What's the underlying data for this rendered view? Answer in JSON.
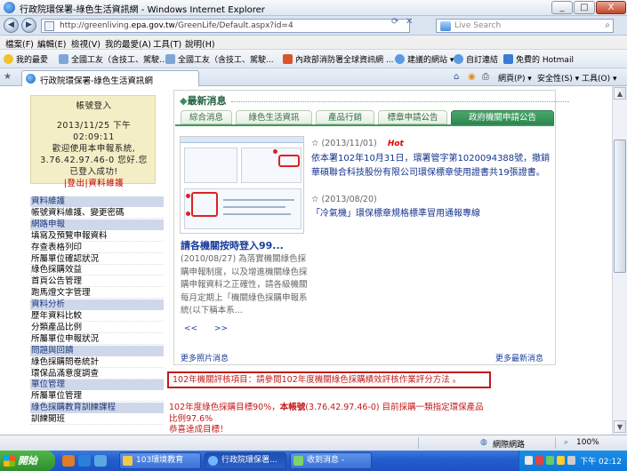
{
  "window": {
    "title": "行政院環保署-綠色生活資訊網 - Windows Internet Explorer",
    "min": "_",
    "max": "□",
    "close": "X"
  },
  "address": {
    "url_prefix": "http://greenliving.",
    "url_domain": "epa.gov.tw",
    "url_rest": "/GreenLife/Default.aspx?id=4",
    "search_placeholder": "Live Search"
  },
  "menu": [
    "檔案(F)",
    "編輯(E)",
    "檢視(V)",
    "我的最愛(A)",
    "工具(T)",
    "說明(H)"
  ],
  "favorites": {
    "label": "我的最愛",
    "items": [
      "全國工友（含技工、駕駛...",
      "全國工友（含技工、駕駛...",
      "內政部消防署全球資訊網 ...",
      "建議的網站 ▾",
      "自訂連結",
      "免費的 Hotmail"
    ]
  },
  "tab": {
    "label": "行政院環保署-綠色生活資訊網",
    "tools": [
      "網頁(P) ▾",
      "安全性(S) ▾",
      "工具(O) ▾"
    ]
  },
  "login": {
    "title": "帳號登入",
    "date": "2013/11/25 下午",
    "time": "02:09:11",
    "welcome": "歡迎使用本申報系統,",
    "ip_line": "3.76.42.97.46-0 您好.您",
    "status": "已登入成功!",
    "logout": "|登出",
    "maintain": "|資料維護"
  },
  "sidenav": [
    {
      "type": "hdr",
      "label": "資料維護"
    },
    {
      "type": "it",
      "label": "帳號資料維護、變更密碼"
    },
    {
      "type": "hdr",
      "label": "網路申報"
    },
    {
      "type": "it",
      "label": "填寫及預覽申報資料"
    },
    {
      "type": "it",
      "label": "存查表格列印"
    },
    {
      "type": "it",
      "label": "所屬單位確認狀況"
    },
    {
      "type": "it",
      "label": "綠色採購效益"
    },
    {
      "type": "it",
      "label": "首頁公告管理"
    },
    {
      "type": "it",
      "label": "跑馬燈文字管理"
    },
    {
      "type": "hdr",
      "label": "資料分析"
    },
    {
      "type": "it",
      "label": "歷年資料比較"
    },
    {
      "type": "it",
      "label": "分類產品比例"
    },
    {
      "type": "it",
      "label": "所屬單位申報狀況"
    },
    {
      "type": "hdr",
      "label": "問題與回饋"
    },
    {
      "type": "it",
      "label": "綠色採購問卷統計"
    },
    {
      "type": "it",
      "label": "環保品滿意度調查"
    },
    {
      "type": "hdr",
      "label": "單位管理"
    },
    {
      "type": "it",
      "label": "所屬單位管理"
    },
    {
      "type": "hdr",
      "label": "綠色採購教育訓練課程"
    },
    {
      "type": "it",
      "label": "訓練開班"
    }
  ],
  "news": {
    "title": "最新消息",
    "tabs": [
      "綜合消息",
      "綠色生活資訊",
      "產品行銷",
      "標章申請公告",
      "政府機關申請公告"
    ],
    "photo_caption": "請各機關按時登入99...",
    "photo_desc": "(2010/08/27) 為落實機關綠色採購申報制度，以及增進機關綠色採購申報資料之正確性，請各級機關每月定期上「機關綠色採購申報系統(以下稱本系...",
    "pager_prev": "<<",
    "pager_next": ">>",
    "items": [
      {
        "date": "(2013/11/01)",
        "hot": "Hot",
        "text": "依本署102年10月31日，環署管字第1020094388號，撤銷華碩聯合科技股份有限公司環保標章使用證書共19張證書。"
      },
      {
        "date": "(2013/08/20)",
        "text": "「冷氣機」環保標章規格標準冒用通報專線"
      }
    ],
    "more_photos": "更多照片消息",
    "more_news": "更多最新消息"
  },
  "notice": "102年機關評核項目：請參閱102年度機關綠色採購績效評核作業評分方法 。",
  "target": {
    "line1": "102年度綠色採購目標90%，",
    "line1_bold": "本帳號",
    "line1_b": "(3.76.42.97.46-0) 目前採購一類指定環保產品",
    "line2": "比例97.6%",
    "line3": "恭喜達成目標！"
  },
  "status": {
    "zone": "網際網路",
    "zoom": "100%"
  },
  "taskbar": {
    "start": "開始",
    "tasks": [
      "103環境教育",
      "行政院環保署...",
      "收到消息 -"
    ],
    "clock": "下午 02:12"
  }
}
